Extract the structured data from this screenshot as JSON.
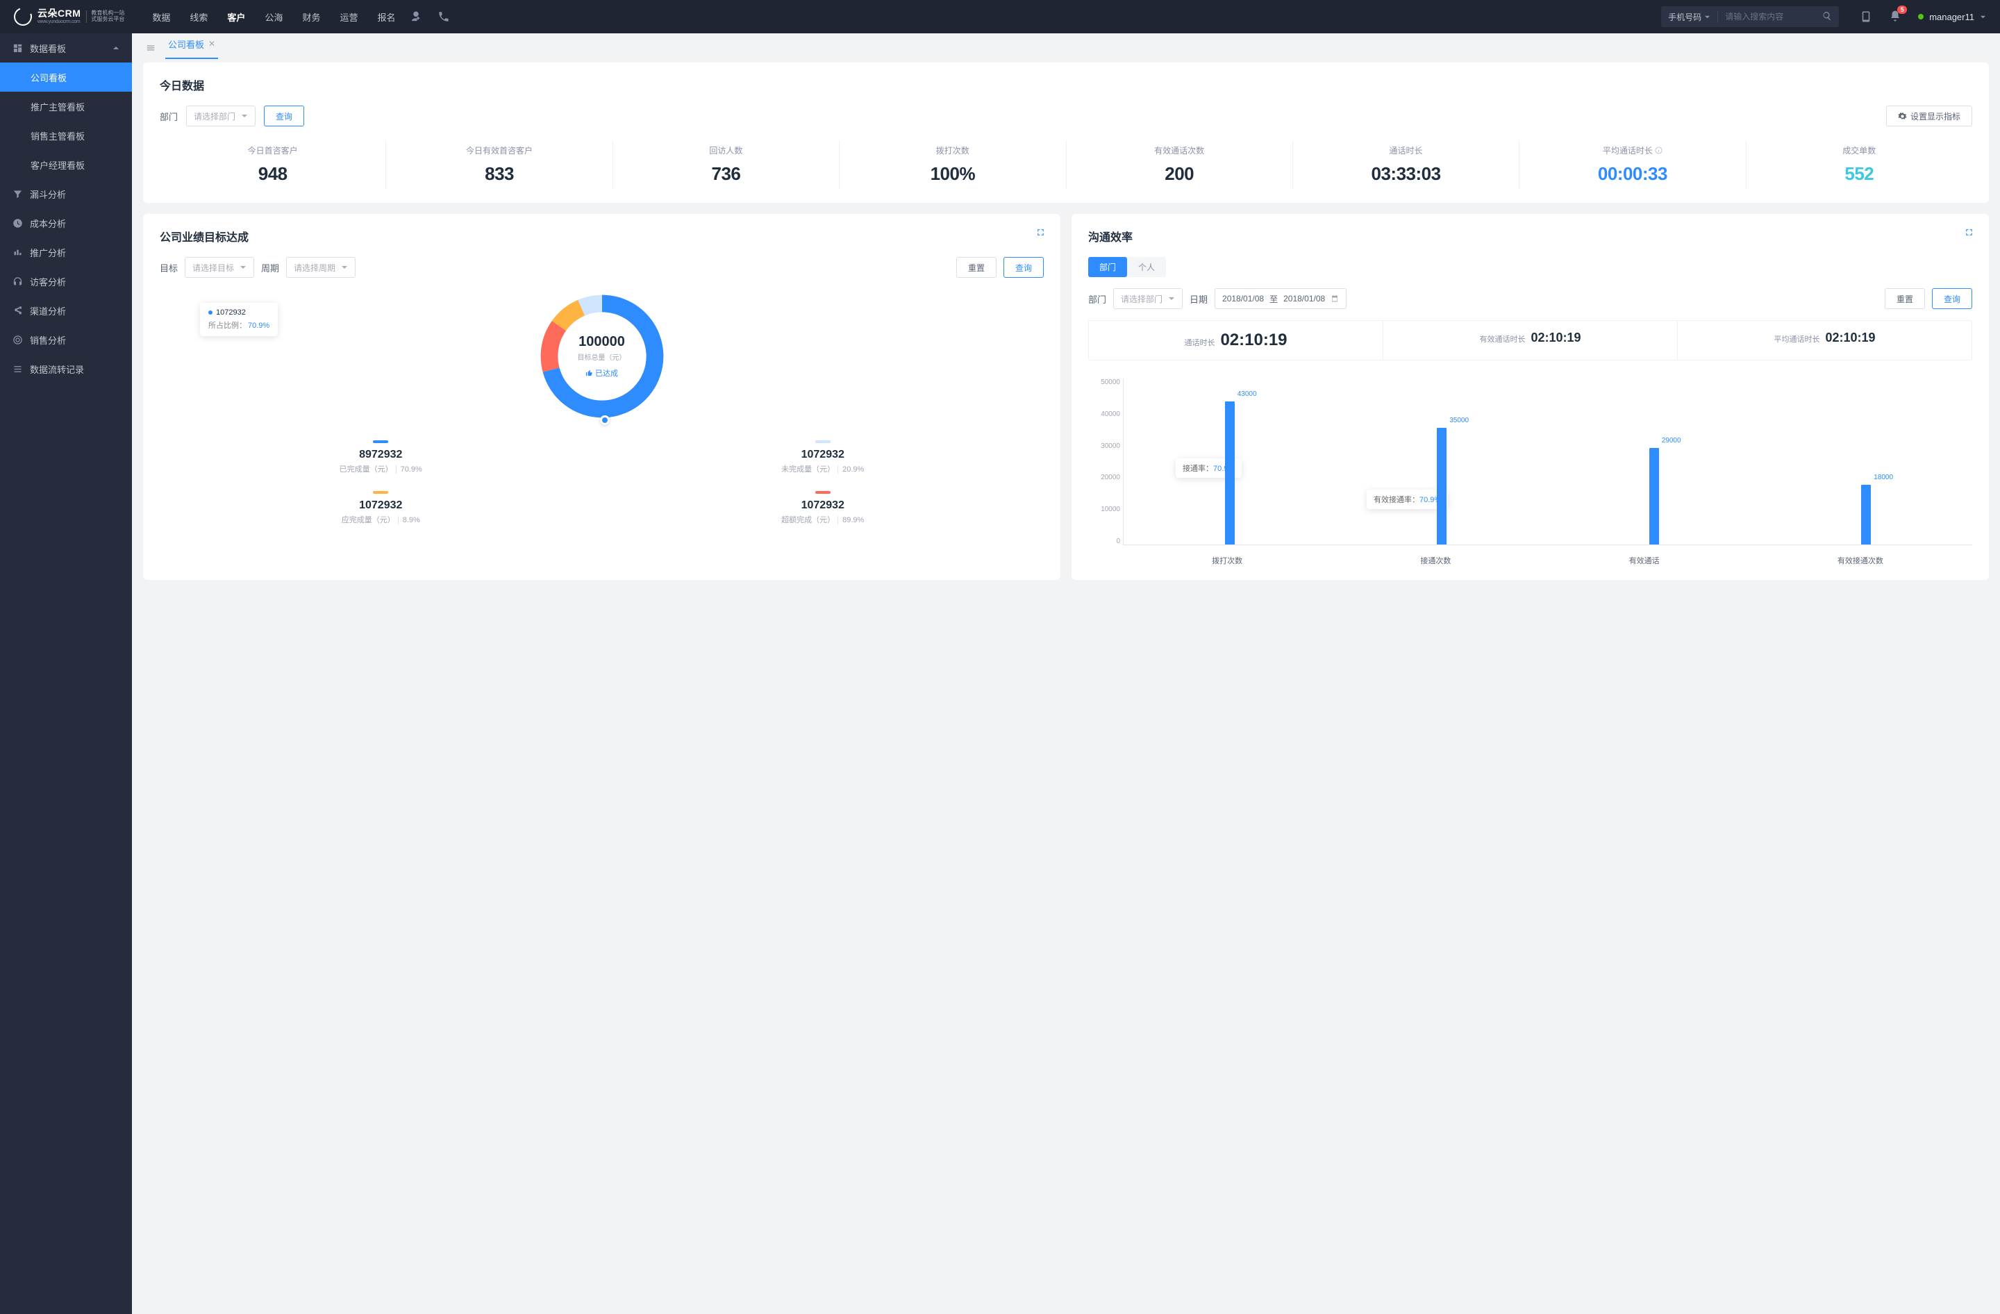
{
  "header": {
    "brand": "云朵CRM",
    "brand_url": "www.yunduocrm.com",
    "brand_sub1": "教育机构一站",
    "brand_sub2": "式服务云平台",
    "nav": [
      "数据",
      "线索",
      "客户",
      "公海",
      "财务",
      "运营",
      "报名"
    ],
    "nav_active_index": 2,
    "search_type": "手机号码",
    "search_placeholder": "请输入搜索内容",
    "badge": "5",
    "user": "manager11"
  },
  "sidebar": {
    "group_label": "数据看板",
    "subs": [
      "公司看板",
      "推广主管看板",
      "销售主管看板",
      "客户经理看板"
    ],
    "sub_active_index": 0,
    "items": [
      "漏斗分析",
      "成本分析",
      "推广分析",
      "访客分析",
      "渠道分析",
      "销售分析",
      "数据流转记录"
    ]
  },
  "tab": {
    "label": "公司看板"
  },
  "today": {
    "title": "今日数据",
    "dept_label": "部门",
    "dept_placeholder": "请选择部门",
    "query_btn": "查询",
    "settings_btn": "设置显示指标",
    "metrics": [
      {
        "label": "今日首咨客户",
        "value": "948"
      },
      {
        "label": "今日有效首咨客户",
        "value": "833"
      },
      {
        "label": "回访人数",
        "value": "736"
      },
      {
        "label": "拨打次数",
        "value": "100%"
      },
      {
        "label": "有效通话次数",
        "value": "200"
      },
      {
        "label": "通话时长",
        "value": "03:33:03"
      },
      {
        "label": "平均通话时长",
        "value": "00:00:33",
        "info": true,
        "cls": "blue"
      },
      {
        "label": "成交单数",
        "value": "552",
        "cls": "cyan"
      }
    ]
  },
  "target": {
    "title": "公司业绩目标达成",
    "target_label": "目标",
    "target_placeholder": "请选择目标",
    "period_label": "周期",
    "period_placeholder": "请选择周期",
    "reset_btn": "重置",
    "query_btn": "查询",
    "center_val": "100000",
    "center_sub": "目标总量（元）",
    "achieved": "已达成",
    "tip_val": "1072932",
    "tip_label": "所占比例：",
    "tip_pct": "70.9%",
    "legends": [
      {
        "color": "#2f8cff",
        "val": "8972932",
        "lab": "已完成量（元）",
        "pct": "70.9%"
      },
      {
        "color": "#cfe4ff",
        "val": "1072932",
        "lab": "未完成量（元）",
        "pct": "20.9%"
      },
      {
        "color": "#ffb340",
        "val": "1072932",
        "lab": "应完成量（元）",
        "pct": "8.9%"
      },
      {
        "color": "#ff6b5a",
        "val": "1072932",
        "lab": "超额完成（元）",
        "pct": "89.9%"
      }
    ]
  },
  "eff": {
    "title": "沟通效率",
    "seg": [
      "部门",
      "个人"
    ],
    "seg_active": 0,
    "dept_label": "部门",
    "dept_placeholder": "请选择部门",
    "date_label": "日期",
    "date_from": "2018/01/08",
    "date_to": "至",
    "date_to_val": "2018/01/08",
    "reset_btn": "重置",
    "query_btn": "查询",
    "stats": [
      {
        "label": "通话时长",
        "value": "02:10:19"
      },
      {
        "label": "有效通话时长",
        "value": "02:10:19"
      },
      {
        "label": "平均通话时长",
        "value": "02:10:19"
      }
    ],
    "tip1_label": "接通率：",
    "tip1_val": "70.9%",
    "tip2_label": "有效接通率：",
    "tip2_val": "70.9%"
  },
  "chart_data": {
    "type": "bar",
    "ylim": [
      0,
      50000
    ],
    "yticks": [
      0,
      10000,
      20000,
      30000,
      40000,
      50000
    ],
    "categories": [
      "拨打次数",
      "接通次数",
      "有效通话",
      "有效接通次数"
    ],
    "values": [
      43000,
      35000,
      29000,
      18000
    ],
    "value_labels": [
      "43000",
      "35000",
      "29000",
      "18000"
    ]
  }
}
